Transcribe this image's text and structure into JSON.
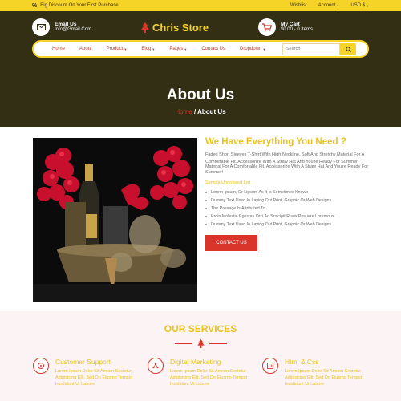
{
  "topbar": {
    "promo": "Big Discount On Your First Purchase",
    "wishlist": "Wishlist",
    "account": "Account",
    "currency": "USD $"
  },
  "header": {
    "email_label": "Email Us",
    "email_value": "Info@Gmail.Com",
    "brand": "Chris Store",
    "cart_label": "My Cart",
    "cart_value": "$0.00 - 0 Items"
  },
  "nav": {
    "items": [
      "Home",
      "About",
      "Product",
      "Blog",
      "Pages",
      "Contact Us",
      "Dropdown"
    ],
    "search_placeholder": "Search"
  },
  "hero": {
    "title": "About Us",
    "crumb_home": "Home",
    "crumb_current": "/ About Us"
  },
  "about": {
    "title": "We Have Everything You Need ?",
    "para1": "Faded Short Sleeves T-Shirt With High Neckline. Soft And Stretchy Material For A Comfortable Fit. Accessorize With A Straw Hat And You're Ready For Summer!",
    "para2": "Material For A Comfortable Fit. Accessorize With A Straw Hat And You're Ready For Summer!",
    "list_title": "Sample Unordered List",
    "bullets": [
      "Lorem Ipsum, Or Lipsum As It Is Sometimes Known",
      "Dummy Text Used In Laying Out Print, Graphic Or Web Designs",
      "The Passage Is Attributed To.",
      "Proin Molestie Egestas Orci Ac Suscipit Risus Posuere Loremous.",
      "Dummy Text Used In Laying Out Print, Graphic Or Web Designs"
    ],
    "button": "CONTACT US"
  },
  "services": {
    "title": "OUR SERVICES",
    "items": [
      {
        "title": "Customer Support",
        "text": "Lorem Ipsum Dolor Sit Amcon Sectetur Adipisicing Elit, Sed Do Eiusmo Tempor Incididunt Ut Labore",
        "icon": "support-icon"
      },
      {
        "title": "Digital Marketing",
        "text": "Lorem Ipsum Dolor Sit Amcon Sectetur Adipisicing Elit, Sed Do Eiusmo Tempor Incididunt Ut Labore",
        "icon": "marketing-icon"
      },
      {
        "title": "Html & Css",
        "text": "Lorem Ipsum Dolor Sit Amcon Sectetur Adipisicing Elit, Sed Do Eiusmo Tempor Incididunt Ut Labore",
        "icon": "code-icon"
      }
    ]
  },
  "colors": {
    "accent_yellow": "#f6d327",
    "dark_bg": "#332f15",
    "accent_red": "#d9352b",
    "services_bg": "#fcf3f5"
  }
}
